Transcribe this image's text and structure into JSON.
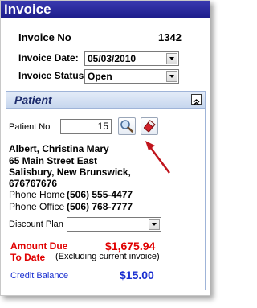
{
  "window": {
    "title": "Invoice"
  },
  "invoice": {
    "number_label": "Invoice No",
    "number_value": "1342",
    "date_label": "Invoice Date:",
    "date_value": "05/03/2010",
    "status_label": "Invoice Status",
    "status_value": "Open"
  },
  "patient_section": {
    "title": "Patient",
    "patient_no_label": "Patient No",
    "patient_no_value": "15",
    "name": "Albert, Christina Mary",
    "address_line1": "65 Main Street East",
    "address_line2": "Salisbury, New Brunswick,",
    "address_line3": "676767676",
    "phone_home_label": "Phone  Home",
    "phone_home_value": "(506) 555-4477",
    "phone_office_label": "Phone Office",
    "phone_office_value": "(506) 768-7777",
    "discount_plan_label": "Discount Plan",
    "discount_plan_value": ""
  },
  "amounts": {
    "amount_due_label_line1": "Amount Due",
    "amount_due_label_line2": "To Date",
    "amount_due_value": "$1,675.94",
    "amount_due_note": "(Excluding current invoice)",
    "credit_balance_label": "Credit Balance",
    "credit_balance_value": "$15.00"
  },
  "icons": {
    "search": "magnifier-icon",
    "clear": "eraser-icon",
    "collapse": "chevron-up-icon",
    "pointer": "arrow-annotation"
  },
  "colors": {
    "title_bar": "#1c1c8a",
    "section_header": "#c6d6ee",
    "amount_due": "#e00000",
    "credit_balance": "#1a2fd0"
  }
}
